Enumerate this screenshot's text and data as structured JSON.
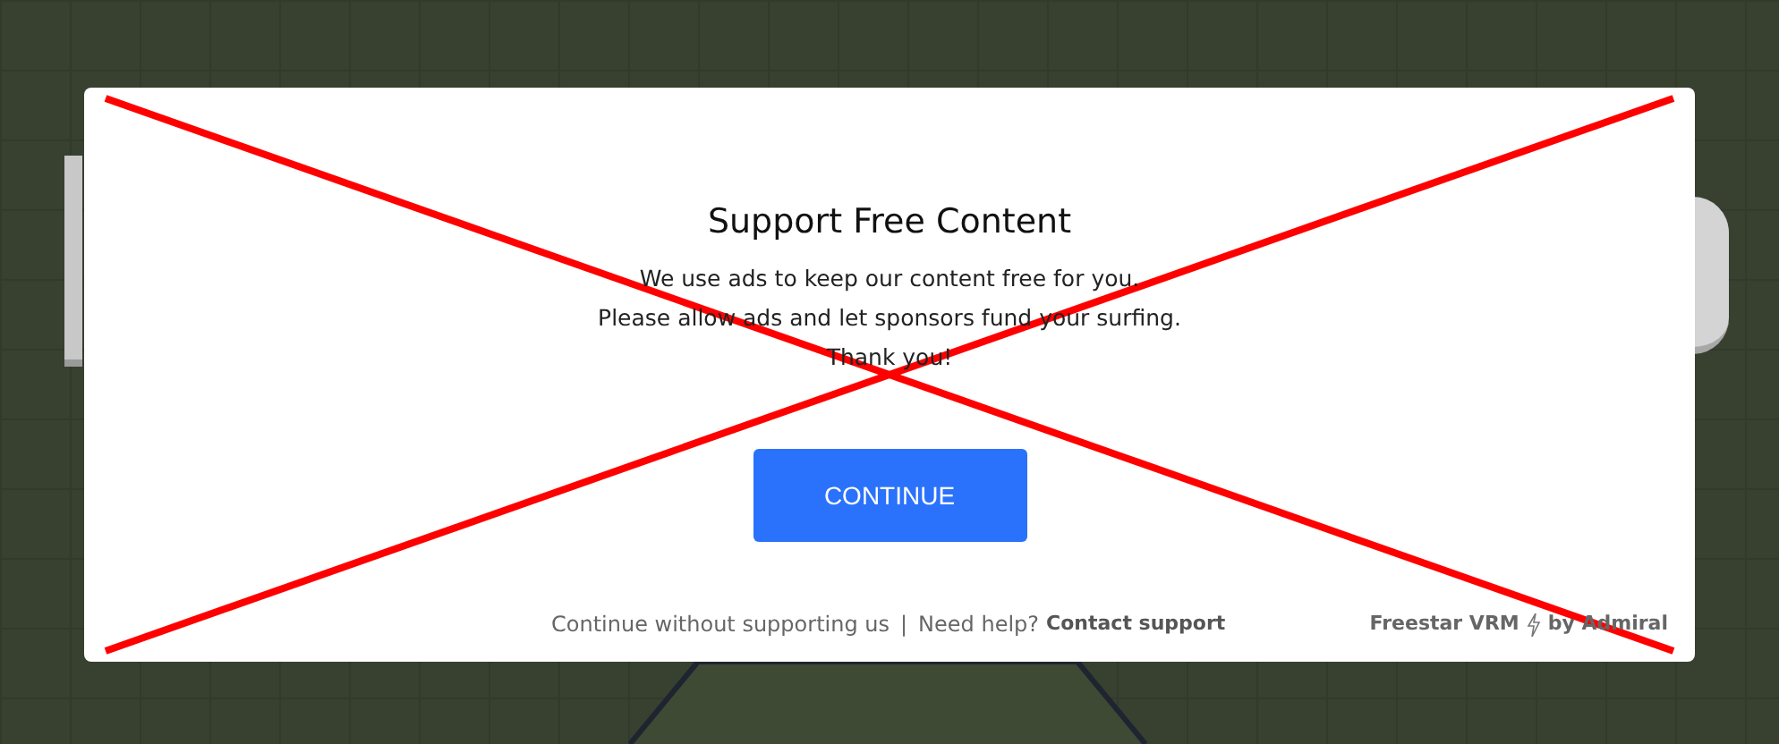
{
  "dialog": {
    "title": "Support Free Content",
    "message_lines": [
      "We use ads to keep our content free for you.",
      "Please allow ads and let sponsors fund your surfing.",
      "Thank you!"
    ],
    "button": "CONTINUE",
    "footer": {
      "skip_link": "Continue without supporting us",
      "separator": "|",
      "help_text": "Need help?",
      "support_link": "Contact support",
      "brand": "Freestar VRM",
      "brand_by": "by Admiral"
    }
  }
}
